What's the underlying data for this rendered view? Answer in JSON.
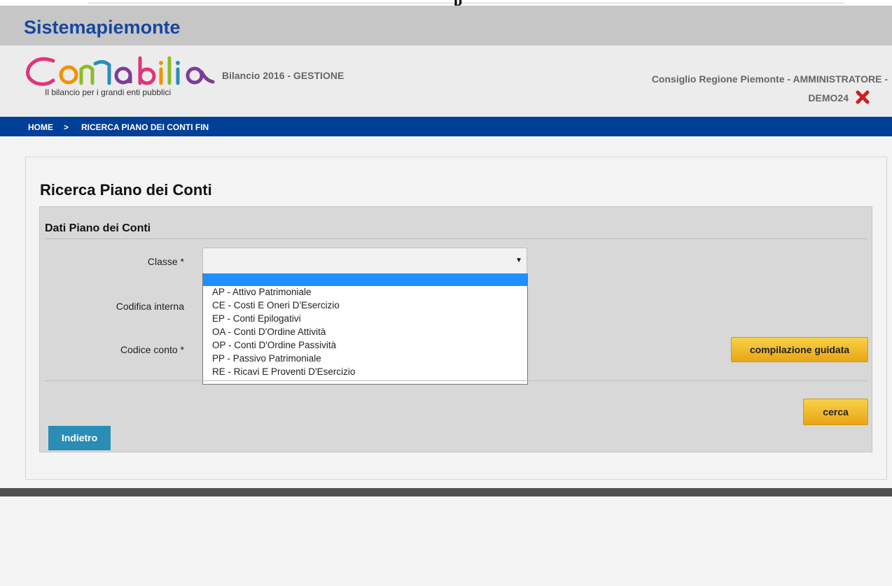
{
  "top_cut_text": "p",
  "brand": "Sistemapiemonte",
  "logo": {
    "wordmark": "Contabilia",
    "tagline": "Il bilancio per i grandi enti pubblici"
  },
  "header": {
    "bilancio": "Bilancio 2016 - GESTIONE",
    "user_line1": "Consiglio Regione Piemonte - AMMINISTRATORE -",
    "user_line2": "DEMO24"
  },
  "breadcrumb": {
    "home": "HOME",
    "sep": ">",
    "current": "RICERCA PIANO DEI CONTI FIN"
  },
  "page": {
    "title": "Ricerca Piano dei Conti",
    "section": "Dati Piano dei Conti"
  },
  "form": {
    "classe_label": "Classe *",
    "classe_value": "",
    "codifica_label": "Codifica interna",
    "codice_label": "Codice conto *",
    "options": [
      "",
      "AP - Attivo Patrimoniale",
      "CE - Costi E Oneri D'Esercizio",
      "EP - Conti Epilogativi",
      "OA - Conti D'Ordine Attività",
      "OP - Conti D'Ordine Passività",
      "PP - Passivo Patrimoniale",
      "RE - Ricavi E Proventi D'Esercizio"
    ]
  },
  "buttons": {
    "compilazione": "compilazione guidata",
    "cerca": "cerca",
    "indietro": "Indietro"
  },
  "icons": {
    "close": "close-x-icon",
    "dropdown": "chevron-down-icon"
  },
  "colors": {
    "brand_blue": "#17479e",
    "breadcrumb_bg": "#003f97",
    "selected_option": "#1e90ff",
    "logout_red": "#d01c1c",
    "button_yellow": "#f2c232",
    "button_blue": "#2a8db6"
  }
}
